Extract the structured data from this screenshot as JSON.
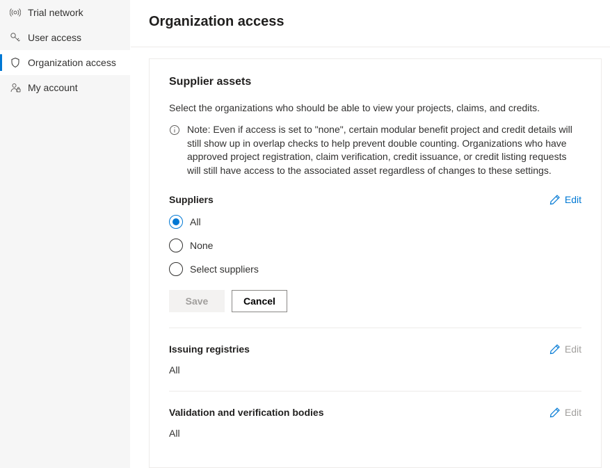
{
  "sidebar": {
    "items": [
      {
        "label": "Trial network",
        "icon": "broadcast"
      },
      {
        "label": "User access",
        "icon": "key"
      },
      {
        "label": "Organization access",
        "icon": "shield"
      },
      {
        "label": "My account",
        "icon": "person"
      }
    ]
  },
  "header": {
    "title": "Organization access"
  },
  "supplier_assets": {
    "title": "Supplier assets",
    "description": "Select the organizations who should be able to view your projects, claims, and credits.",
    "note": "Note: Even if access is set to \"none\", certain modular benefit project and credit details will still show up in overlap checks to help prevent double counting. Organizations who have approved project registration, claim verification, credit issuance, or credit listing requests will still have access to the associated asset regardless of changes to these settings."
  },
  "suppliers": {
    "title": "Suppliers",
    "edit": "Edit",
    "options": {
      "all": "All",
      "none": "None",
      "select": "Select suppliers"
    },
    "buttons": {
      "save": "Save",
      "cancel": "Cancel"
    }
  },
  "registries": {
    "title": "Issuing registries",
    "edit": "Edit",
    "value": "All"
  },
  "vvb": {
    "title": "Validation and verification bodies",
    "edit": "Edit",
    "value": "All"
  }
}
